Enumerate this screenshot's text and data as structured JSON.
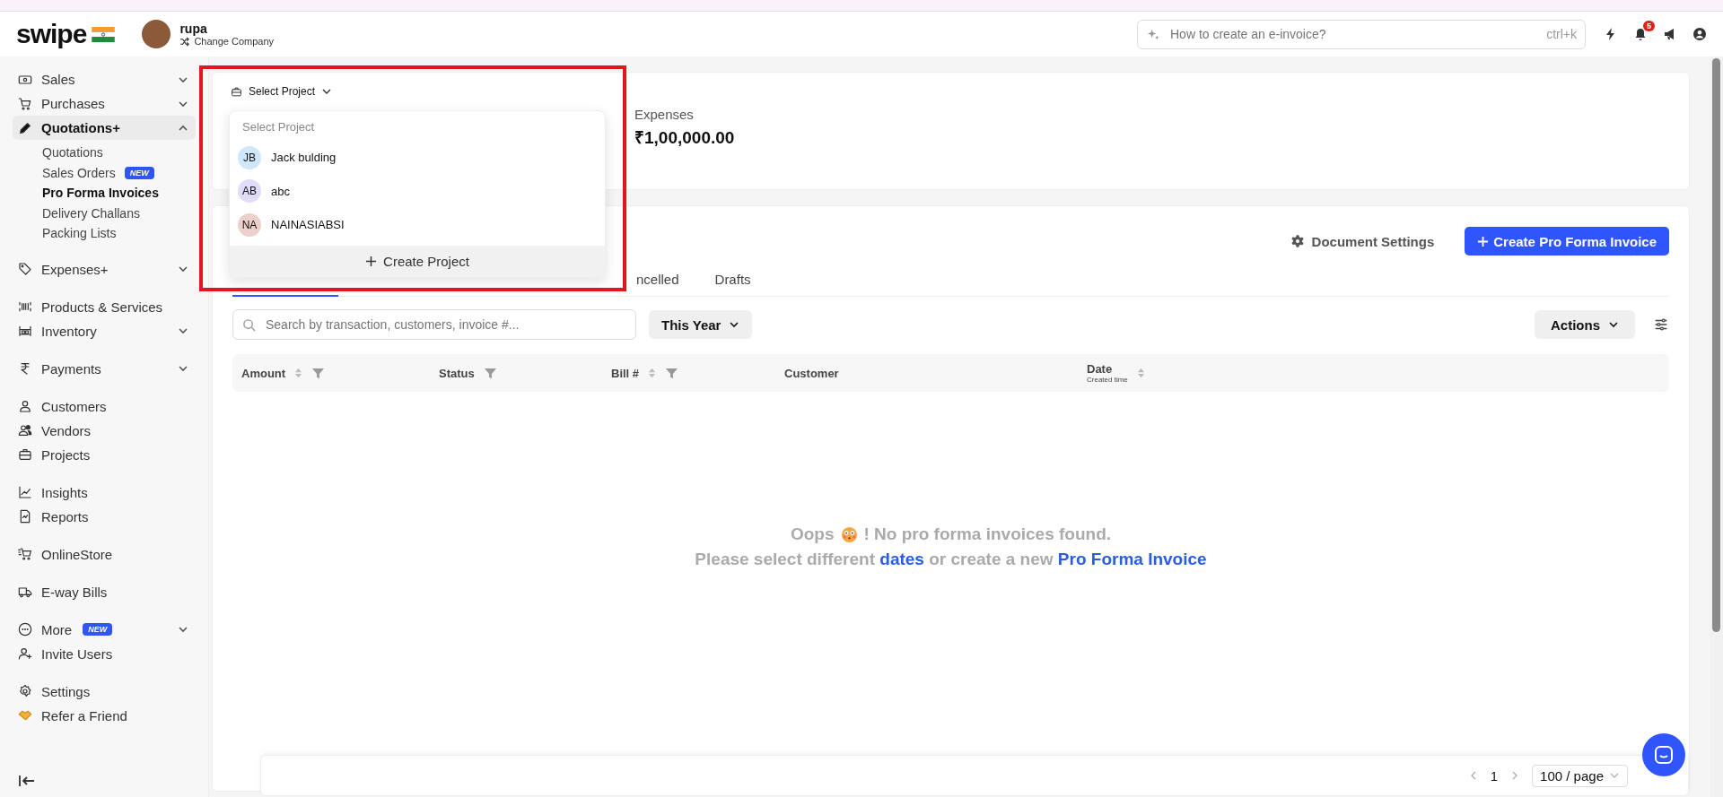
{
  "topbar": {
    "logo": "swipe",
    "company": {
      "name": "rupa",
      "action": "Change Company"
    },
    "search": {
      "placeholder": "How to create an e-invoice?",
      "shortcut": "ctrl+k"
    },
    "notifications": "5"
  },
  "sidebar": {
    "sections": [
      {
        "items": [
          {
            "label": "Sales",
            "kind": "group",
            "expanded": false,
            "selected": false
          },
          {
            "label": "Purchases",
            "kind": "group",
            "expanded": false,
            "selected": false
          },
          {
            "label": "Quotations+",
            "kind": "group",
            "expanded": true,
            "selected": true,
            "children": [
              {
                "label": "Quotations",
                "selected": false
              },
              {
                "label": "Sales Orders",
                "badge": "NEW",
                "selected": false
              },
              {
                "label": "Pro Forma Invoices",
                "selected": true
              },
              {
                "label": "Delivery Challans",
                "selected": false
              },
              {
                "label": "Packing Lists",
                "selected": false
              }
            ]
          }
        ]
      },
      {
        "items": [
          {
            "label": "Expenses+",
            "kind": "group",
            "expanded": false,
            "selected": false
          }
        ]
      },
      {
        "items": [
          {
            "label": "Products & Services",
            "kind": "link",
            "selected": false
          },
          {
            "label": "Inventory",
            "kind": "group",
            "expanded": false,
            "selected": false
          }
        ]
      },
      {
        "items": [
          {
            "label": "Payments",
            "kind": "group",
            "expanded": false,
            "selected": false
          }
        ]
      },
      {
        "items": [
          {
            "label": "Customers",
            "kind": "link",
            "selected": false
          },
          {
            "label": "Vendors",
            "kind": "link",
            "selected": false
          },
          {
            "label": "Projects",
            "kind": "link",
            "selected": false
          }
        ]
      },
      {
        "items": [
          {
            "label": "Insights",
            "kind": "link",
            "selected": false
          },
          {
            "label": "Reports",
            "kind": "link",
            "selected": false
          }
        ]
      },
      {
        "items": [
          {
            "label": "OnlineStore",
            "kind": "link",
            "selected": false
          }
        ]
      },
      {
        "items": [
          {
            "label": "E-way Bills",
            "kind": "link",
            "selected": false
          }
        ]
      },
      {
        "items": [
          {
            "label": "More",
            "kind": "group",
            "badge": "NEW",
            "expanded": false,
            "selected": false
          },
          {
            "label": "Invite Users",
            "kind": "link",
            "selected": false
          }
        ]
      },
      {
        "items": [
          {
            "label": "Settings",
            "kind": "link",
            "selected": false
          },
          {
            "label": "Refer a Friend",
            "kind": "link",
            "selected": false
          }
        ]
      }
    ]
  },
  "summary": {
    "project_selector": "Select Project",
    "expenses": {
      "label": "Expenses",
      "value": "₹1,00,000.00"
    }
  },
  "project_dropdown": {
    "header": "Select Project",
    "options": [
      {
        "initials": "JB",
        "name": "Jack bulding",
        "color": "#cfe6fb"
      },
      {
        "initials": "AB",
        "name": "abc",
        "color": "#e2dcfb"
      },
      {
        "initials": "NA",
        "name": "NAINASIABSI",
        "color": "#ecd0cc"
      }
    ],
    "create": "Create Project"
  },
  "toolbar": {
    "settings": "Document Settings",
    "create": "Create Pro Forma Invoice"
  },
  "tabs": [
    {
      "label": "ncelled",
      "selected": false
    },
    {
      "label": "Drafts",
      "selected": false
    }
  ],
  "filters": {
    "search_placeholder": "Search by transaction, customers, invoice #...",
    "period": "This Year",
    "actions": "Actions"
  },
  "table": {
    "columns": [
      {
        "label": "Amount",
        "sortable": true,
        "filter": true
      },
      {
        "label": "Status",
        "sortable": false,
        "filter": true
      },
      {
        "label": "Bill #",
        "sortable": true,
        "filter": true
      },
      {
        "label": "Customer",
        "sortable": false,
        "filter": false
      },
      {
        "label": "Date",
        "sub": "Created time",
        "sortable": true,
        "filter": false
      }
    ]
  },
  "empty": {
    "title_start": "Oops",
    "title_end": "! No pro forma invoices found.",
    "hint_start": "Please select different",
    "hint_link_1": "dates",
    "hint_middle": "or create a new",
    "hint_link_2": "Pro Forma Invoice"
  },
  "pagination": {
    "page": "1",
    "page_size": "100 / page"
  }
}
